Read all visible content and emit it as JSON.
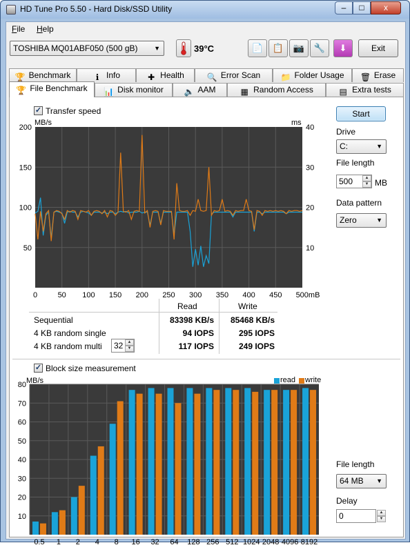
{
  "window": {
    "title": "HD Tune Pro 5.50 - Hard Disk/SSD Utility",
    "controls": {
      "minimize": "–",
      "maximize": "□",
      "close": "x"
    }
  },
  "menu": [
    {
      "label": "File",
      "accel": "F",
      "rest": "ile"
    },
    {
      "label": "Help",
      "accel": "H",
      "rest": "elp"
    }
  ],
  "toolbar": {
    "drive": "TOSHIBA MQ01ABF050 (500 gB)",
    "temperature": "39°C",
    "buttons": [
      {
        "icon": "copy-text-icon",
        "glyph": "📄"
      },
      {
        "icon": "copy-screenshot-icon",
        "glyph": "📋"
      },
      {
        "icon": "camera-icon",
        "glyph": "📷"
      },
      {
        "icon": "options-icon",
        "glyph": "🔧"
      },
      {
        "icon": "download-icon",
        "glyph": "⬇"
      }
    ],
    "exit_label": "Exit"
  },
  "tabs_row1": [
    {
      "label": "Benchmark",
      "icon": "benchmark-icon",
      "glyph": "🏆"
    },
    {
      "label": "Info",
      "icon": "info-icon",
      "glyph": "ℹ"
    },
    {
      "label": "Health",
      "icon": "health-icon",
      "glyph": "✚"
    },
    {
      "label": "Error Scan",
      "icon": "error-scan-icon",
      "glyph": "🔍"
    },
    {
      "label": "Folder Usage",
      "icon": "folder-icon",
      "glyph": "📁"
    },
    {
      "label": "Erase",
      "icon": "trash-icon",
      "glyph": "🗑"
    }
  ],
  "tabs_row2": [
    {
      "label": "File Benchmark",
      "icon": "file-benchmark-icon",
      "glyph": "🏆",
      "active": true
    },
    {
      "label": "Disk monitor",
      "icon": "disk-monitor-icon",
      "glyph": "📊",
      "active": false
    },
    {
      "label": "AAM",
      "icon": "speaker-icon",
      "glyph": "🔈",
      "active": false
    },
    {
      "label": "Random Access",
      "icon": "random-access-icon",
      "glyph": "▦",
      "active": false
    },
    {
      "label": "Extra tests",
      "icon": "extra-tests-icon",
      "glyph": "▤",
      "active": false
    }
  ],
  "transfer": {
    "checkbox_label": "Transfer speed",
    "checked": true,
    "y_left_unit": "MB/s",
    "y_right_unit": "ms",
    "y_left_ticks": [
      "200",
      "150",
      "100",
      "50"
    ],
    "y_right_ticks": [
      "40",
      "30",
      "20",
      "10"
    ],
    "x_ticks": [
      "0",
      "50",
      "100",
      "150",
      "200",
      "250",
      "300",
      "350",
      "400",
      "450",
      "500mB"
    ]
  },
  "results": {
    "col_read": "Read",
    "col_write": "Write",
    "rows": [
      {
        "label": "Sequential",
        "read": "83398 KB/s",
        "write": "85468 KB/s"
      },
      {
        "label": "4 KB random single",
        "read": "94 IOPS",
        "write": "295 IOPS"
      },
      {
        "label": "4 KB random multi",
        "read": "117 IOPS",
        "write": "249 IOPS"
      }
    ],
    "queue_depth": "32"
  },
  "block": {
    "checkbox_label": "Block size measurement",
    "checked": true,
    "y_unit": "MB/s",
    "legend_read": "read",
    "legend_write": "write"
  },
  "side": {
    "start_label": "Start",
    "drive_label": "Drive",
    "drive_value": "C:",
    "file_length_label": "File length",
    "file_length_value": "500",
    "file_length_unit": "MB",
    "pattern_label": "Data pattern",
    "pattern_value": "Zero",
    "block_file_length_label": "File length",
    "block_file_length_value": "64 MB",
    "delay_label": "Delay",
    "delay_value": "0"
  },
  "colors": {
    "read": "#1aa3d8",
    "write": "#e07b17",
    "plot_bg": "#3a3a3a",
    "grid": "#5a5a5a"
  },
  "chart_data": [
    {
      "type": "line",
      "title": "",
      "xlabel": "",
      "ylabel": "MB/s",
      "xlim": [
        0,
        500
      ],
      "ylim": [
        0,
        200
      ],
      "y2label": "ms",
      "y2lim": [
        0,
        40
      ],
      "grid": true,
      "series": [
        {
          "name": "Read",
          "x": [
            0,
            5,
            10,
            15,
            20,
            25,
            30,
            35,
            40,
            45,
            50,
            55,
            60,
            65,
            70,
            75,
            80,
            85,
            90,
            95,
            100,
            105,
            110,
            115,
            120,
            125,
            130,
            135,
            140,
            145,
            150,
            155,
            160,
            165,
            170,
            175,
            180,
            185,
            190,
            195,
            200,
            205,
            210,
            215,
            220,
            225,
            230,
            235,
            240,
            245,
            250,
            255,
            260,
            265,
            270,
            275,
            280,
            285,
            290,
            295,
            300,
            305,
            310,
            315,
            320,
            325,
            330,
            335,
            340,
            345,
            350,
            355,
            360,
            365,
            370,
            375,
            380,
            385,
            390,
            395,
            400,
            405,
            410,
            415,
            420,
            425,
            430,
            435,
            440,
            445,
            450,
            455,
            460,
            465,
            470,
            475,
            480,
            485,
            490,
            495,
            500
          ],
          "y": [
            93,
            95,
            112,
            65,
            90,
            94,
            62,
            94,
            95,
            94,
            93,
            80,
            94,
            95,
            94,
            94,
            88,
            94,
            95,
            94,
            93,
            90,
            94,
            94,
            94,
            93,
            94,
            92,
            94,
            94,
            92,
            94,
            95,
            94,
            95,
            93,
            94,
            94,
            94,
            95,
            93,
            94,
            94,
            78,
            94,
            94,
            94,
            80,
            94,
            94,
            94,
            94,
            66,
            94,
            94,
            94,
            94,
            94,
            70,
            26,
            48,
            28,
            52,
            26,
            40,
            30,
            92,
            94,
            94,
            94,
            94,
            94,
            94,
            94,
            88,
            94,
            94,
            94,
            94,
            94,
            94,
            94,
            70,
            94,
            94,
            92,
            94,
            94,
            94,
            94,
            94,
            94,
            94,
            94,
            92,
            94,
            94,
            94,
            94,
            94,
            94
          ]
        },
        {
          "name": "Write",
          "x": [
            0,
            5,
            10,
            15,
            20,
            25,
            30,
            35,
            40,
            45,
            50,
            55,
            60,
            65,
            70,
            75,
            80,
            85,
            90,
            95,
            100,
            105,
            110,
            115,
            120,
            125,
            130,
            135,
            140,
            145,
            150,
            155,
            160,
            165,
            170,
            175,
            180,
            185,
            190,
            195,
            200,
            205,
            210,
            215,
            220,
            225,
            230,
            235,
            240,
            245,
            250,
            255,
            260,
            265,
            270,
            275,
            280,
            285,
            290,
            295,
            300,
            305,
            310,
            315,
            320,
            325,
            330,
            335,
            340,
            345,
            350,
            355,
            360,
            365,
            370,
            375,
            380,
            385,
            390,
            395,
            400,
            405,
            410,
            415,
            420,
            425,
            430,
            435,
            440,
            445,
            450,
            455,
            460,
            465,
            470,
            475,
            480,
            485,
            490,
            495,
            500
          ],
          "y": [
            92,
            60,
            95,
            70,
            92,
            96,
            58,
            94,
            96,
            95,
            92,
            85,
            96,
            94,
            96,
            95,
            85,
            96,
            95,
            94,
            96,
            90,
            95,
            96,
            95,
            92,
            96,
            88,
            96,
            95,
            90,
            94,
            168,
            95,
            94,
            96,
            85,
            95,
            96,
            95,
            190,
            93,
            96,
            75,
            95,
            96,
            95,
            78,
            96,
            95,
            95,
            95,
            60,
            130,
            96,
            95,
            95,
            96,
            90,
            96,
            95,
            110,
            96,
            95,
            96,
            150,
            90,
            96,
            95,
            96,
            110,
            95,
            96,
            95,
            90,
            96,
            95,
            96,
            96,
            110,
            96,
            95,
            72,
            96,
            95,
            90,
            96,
            95,
            96,
            95,
            96,
            95,
            96,
            95,
            92,
            96,
            95,
            96,
            96,
            95,
            96
          ]
        }
      ]
    },
    {
      "type": "bar",
      "title": "",
      "xlabel": "",
      "ylabel": "MB/s",
      "ylim": [
        0,
        80
      ],
      "grid": true,
      "categories": [
        "0.5",
        "1",
        "2",
        "4",
        "8",
        "16",
        "32",
        "64",
        "128",
        "256",
        "512",
        "1024",
        "2048",
        "4096",
        "8192"
      ],
      "series": [
        {
          "name": "read",
          "values": [
            7,
            12,
            20,
            42,
            59,
            77,
            78,
            78,
            78,
            78,
            78,
            78,
            77,
            77,
            78
          ]
        },
        {
          "name": "write",
          "values": [
            6,
            13,
            26,
            47,
            71,
            75,
            75,
            70,
            75,
            77,
            77,
            76,
            77,
            77,
            77
          ]
        }
      ]
    }
  ]
}
